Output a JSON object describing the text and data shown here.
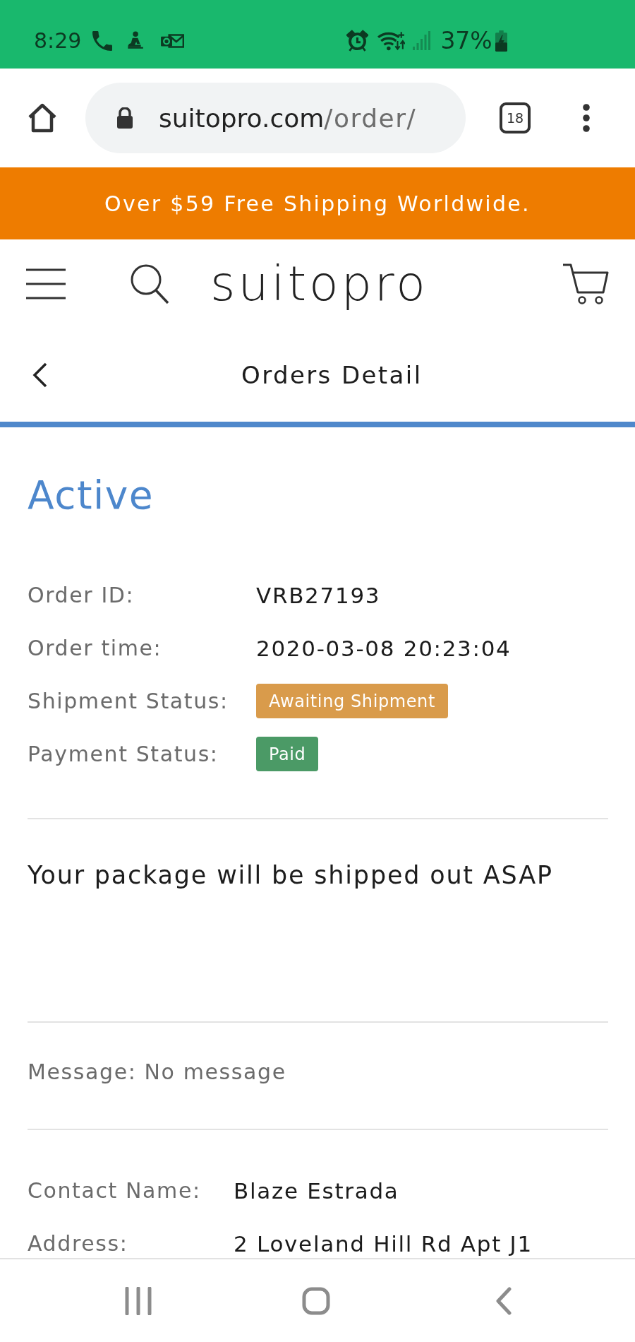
{
  "status_bar": {
    "time": "8:29",
    "battery": "37%"
  },
  "browser": {
    "url_host": "suitopro.com",
    "url_path": "/order/",
    "tab_count": "18"
  },
  "banner": {
    "text": "Over $59 Free Shipping Worldwide."
  },
  "header": {
    "logo": "suitopro"
  },
  "page_header": {
    "title": "Orders Detail"
  },
  "order": {
    "status": "Active",
    "fields": [
      {
        "label": "Order ID:",
        "kind": "text",
        "value": "VRB27193"
      },
      {
        "label": "Order time:",
        "kind": "text",
        "value": "2020-03-08 20:23:04"
      },
      {
        "label": "Shipment Status:",
        "kind": "badge",
        "value": "Awaiting Shipment",
        "color": "#d99b4b"
      },
      {
        "label": "Payment Status:",
        "kind": "badge",
        "value": "Paid",
        "color": "#4b9a66"
      }
    ]
  },
  "notice": "Your package will be shipped out ASAP",
  "message": "Message: No message",
  "contact": [
    {
      "label": "Contact Name:",
      "value": "Blaze Estrada"
    },
    {
      "label": "Address:",
      "value": "2 Loveland Hill Rd Apt J1"
    }
  ]
}
